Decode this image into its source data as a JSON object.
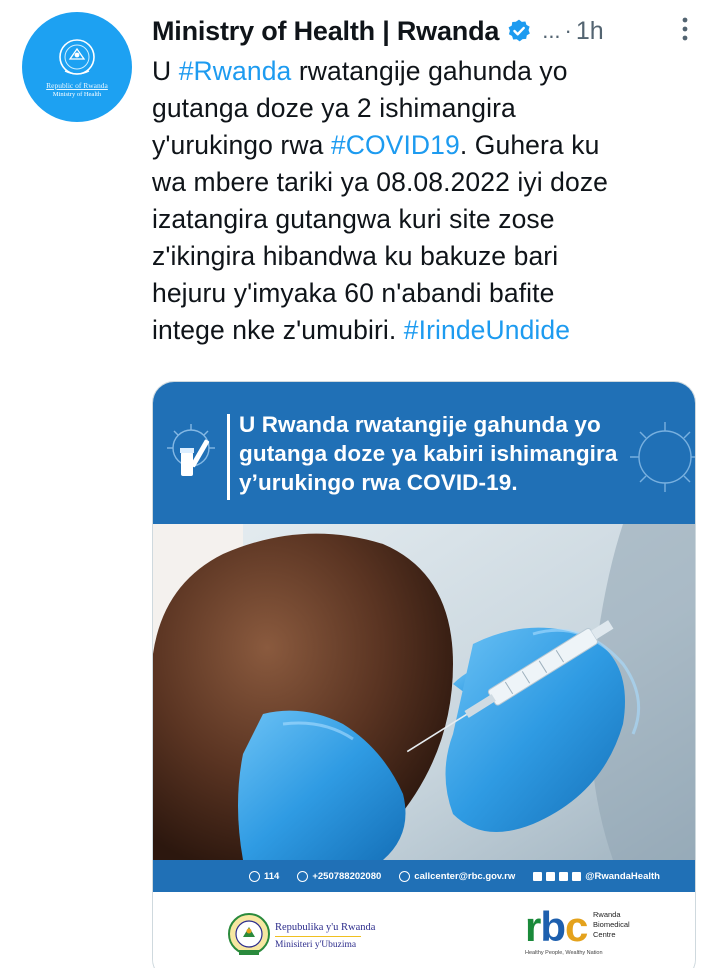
{
  "colors": {
    "accent": "#1d9bf0",
    "muted": "#536471",
    "banner": "#2070b6",
    "glove": "#3aa4e8"
  },
  "author": {
    "display_name": "Ministry of Health | Rwanda",
    "handle_truncated": "...",
    "separator": "·",
    "time": "1h",
    "avatar": {
      "line1": "Republic of Rwanda",
      "line2": "Ministry of Health"
    },
    "verified_icon": "verified-badge-icon",
    "more_icon": "more-options-icon"
  },
  "tweet": {
    "lines": [
      {
        "pre": "U ",
        "link": "#Rwanda",
        "post": " rwatangije gahunda yo"
      },
      {
        "pre": "gutanga doze ya 2 ishimangira",
        "link": "",
        "post": ""
      },
      {
        "pre": "y'urukingo rwa ",
        "link": "#COVID19",
        "post": ". Guhera ku"
      },
      {
        "pre": "wa mbere tariki ya 08.08.2022 iyi doze",
        "link": "",
        "post": ""
      },
      {
        "pre": "izatangira gutangwa kuri site zose",
        "link": "",
        "post": ""
      },
      {
        "pre": "z'ikingira hibandwa ku bakuze bari",
        "link": "",
        "post": ""
      },
      {
        "pre": "hejuru y'imyaka 60 n'abandi bafite",
        "link": "",
        "post": ""
      },
      {
        "pre": "intege nke z'umubiri. ",
        "link": "#IrindeUndide",
        "post": ""
      }
    ]
  },
  "media": {
    "banner_lines": [
      "U Rwanda rwatangije gahunda yo",
      "gutanga doze ya kabiri ishimangira",
      "y’urukingo rwa COVID-19."
    ],
    "contact": {
      "hotline": "114",
      "phone": "+250788202080",
      "email": "callcenter@rbc.gov.rw",
      "social": "@RwandaHealth"
    },
    "footer": {
      "gov_line1": "Repubulika y'u Rwanda",
      "gov_line2": "Minisiteri y'Ubuzima",
      "rbc_r": "r",
      "rbc_b": "b",
      "rbc_c": "c",
      "rbc_side": [
        "Rwanda",
        "Biomedical",
        "Centre"
      ],
      "rbc_tagline": "Healthy People, Wealthy Nation"
    }
  }
}
